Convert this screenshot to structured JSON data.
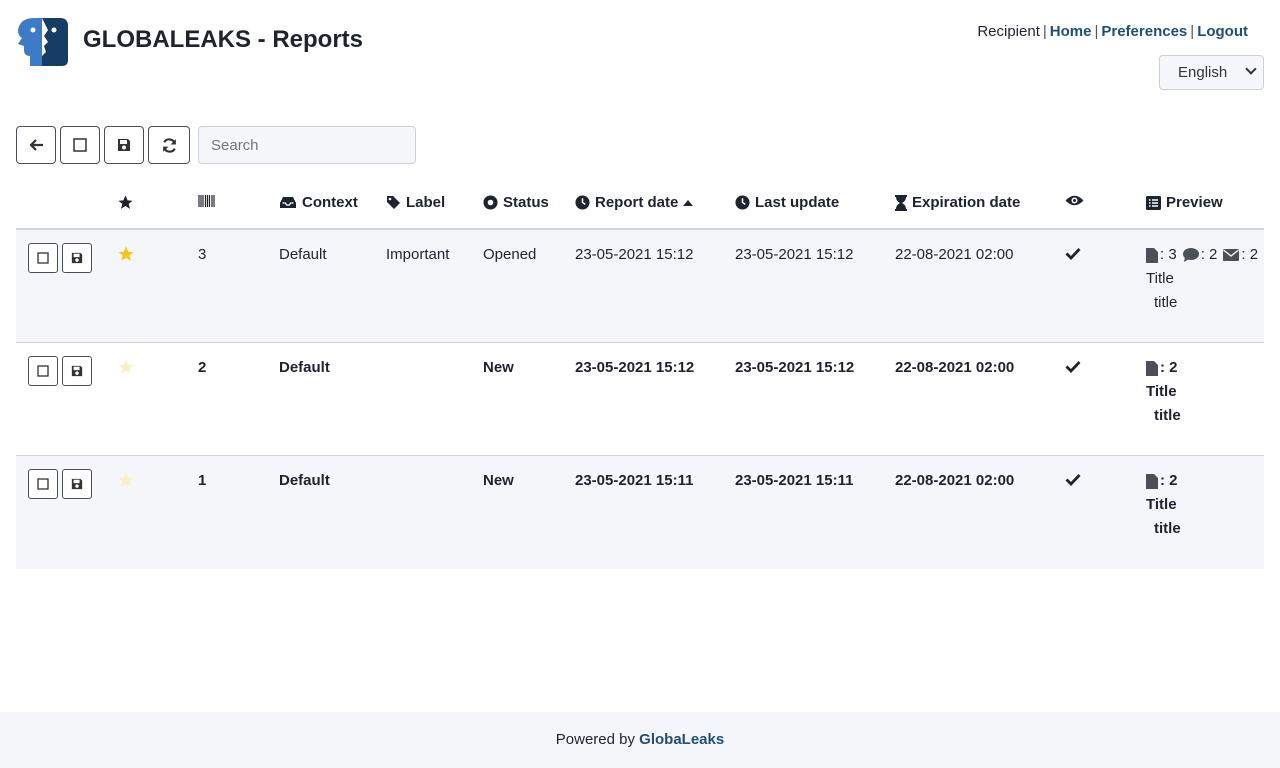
{
  "header": {
    "title": "GLOBALEAKS - Reports",
    "role": "Recipient",
    "nav": {
      "home": "Home",
      "preferences": "Preferences",
      "logout": "Logout"
    },
    "language": "English"
  },
  "toolbar": {
    "search_placeholder": "Search"
  },
  "table": {
    "columns": {
      "context": "Context",
      "label": "Label",
      "status": "Status",
      "report_date": "Report date",
      "last_update": "Last update",
      "expiration_date": "Expiration date",
      "preview": "Preview"
    },
    "rows": [
      {
        "starred": true,
        "progressive": "3",
        "context": "Default",
        "label": "Important",
        "status": "Opened",
        "report_date": "23-05-2021 15:12",
        "last_update": "23-05-2021 15:12",
        "expiration_date": "22-08-2021 02:00",
        "files": ": 3",
        "comments": ": 2",
        "messages": ": 2",
        "preview_title": "Title",
        "preview_value": "title",
        "unread": false
      },
      {
        "starred": false,
        "progressive": "2",
        "context": "Default",
        "label": "",
        "status": "New",
        "report_date": "23-05-2021 15:12",
        "last_update": "23-05-2021 15:12",
        "expiration_date": "22-08-2021 02:00",
        "files": ": 2",
        "preview_title": "Title",
        "preview_value": "title",
        "unread": true
      },
      {
        "starred": false,
        "progressive": "1",
        "context": "Default",
        "label": "",
        "status": "New",
        "report_date": "23-05-2021 15:11",
        "last_update": "23-05-2021 15:11",
        "expiration_date": "22-08-2021 02:00",
        "files": ": 2",
        "preview_title": "Title",
        "preview_value": "title",
        "unread": true
      }
    ]
  },
  "footer": {
    "powered_by": "Powered by",
    "brand": "GlobaLeaks"
  },
  "colors": {
    "accent": "#1f4e79",
    "star_on": "#f5c518",
    "star_off": "#fdf0c0",
    "row_stripe": "#f4f6fa"
  }
}
